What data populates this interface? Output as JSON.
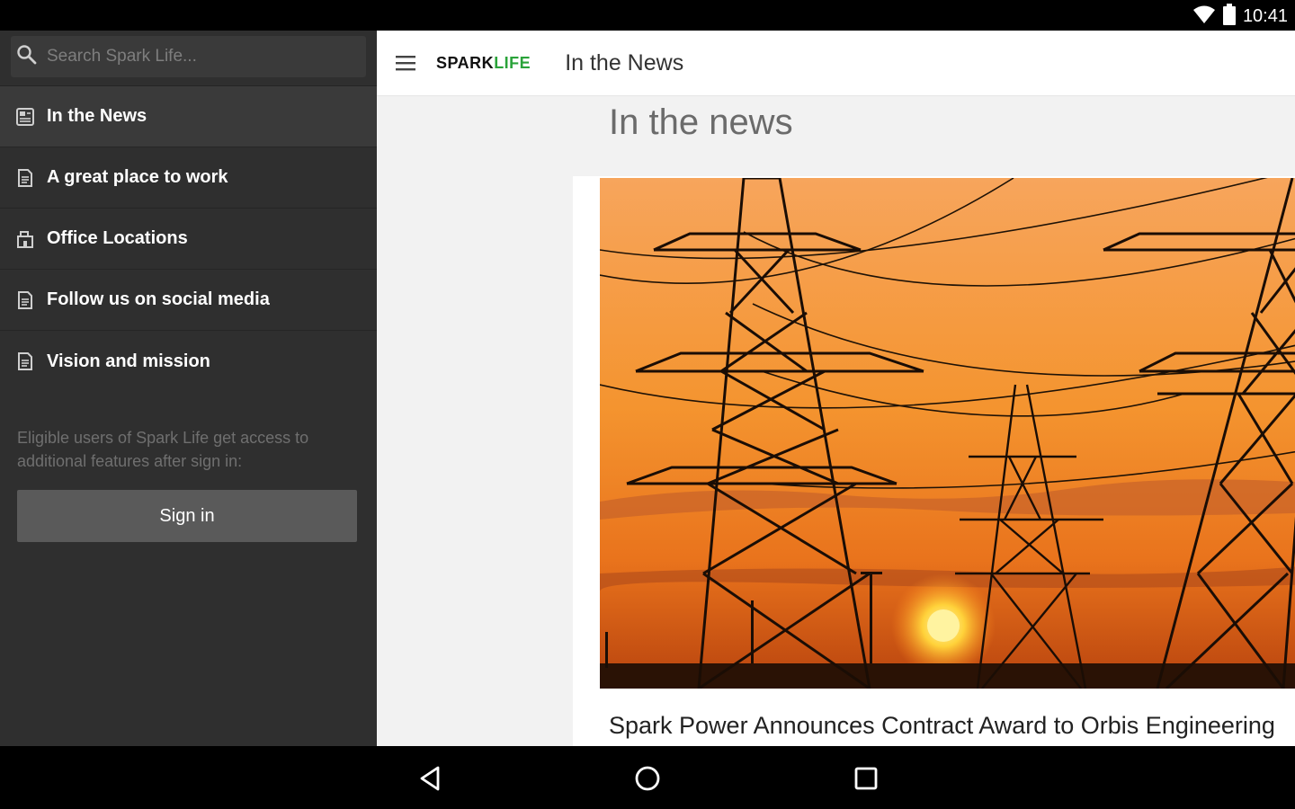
{
  "status_bar": {
    "time": "10:41",
    "icons": [
      "wifi-icon",
      "battery-icon"
    ]
  },
  "sidebar": {
    "search_placeholder": "Search Spark Life...",
    "items": [
      {
        "label": "In the News",
        "icon": "newspaper-icon",
        "active": true
      },
      {
        "label": "A great place to work",
        "icon": "document-icon"
      },
      {
        "label": "Office Locations",
        "icon": "building-icon"
      },
      {
        "label": "Follow us on social media",
        "icon": "document-icon"
      },
      {
        "label": "Vision and mission",
        "icon": "document-icon"
      }
    ],
    "signin_note": "Eligible users of Spark Life get access to additional features after sign in:",
    "signin_button": "Sign in"
  },
  "app_bar": {
    "logo_spark": "SPARK",
    "logo_life": "LIFE",
    "title": "In the News"
  },
  "content": {
    "heading": "In the news",
    "article_title": "Spark Power Announces Contract Award to Orbis Engineering"
  },
  "colors": {
    "accent": "#2aa33a",
    "sidebar_bg": "#2f2f2f",
    "sunset_orange": "#f08a2a"
  }
}
